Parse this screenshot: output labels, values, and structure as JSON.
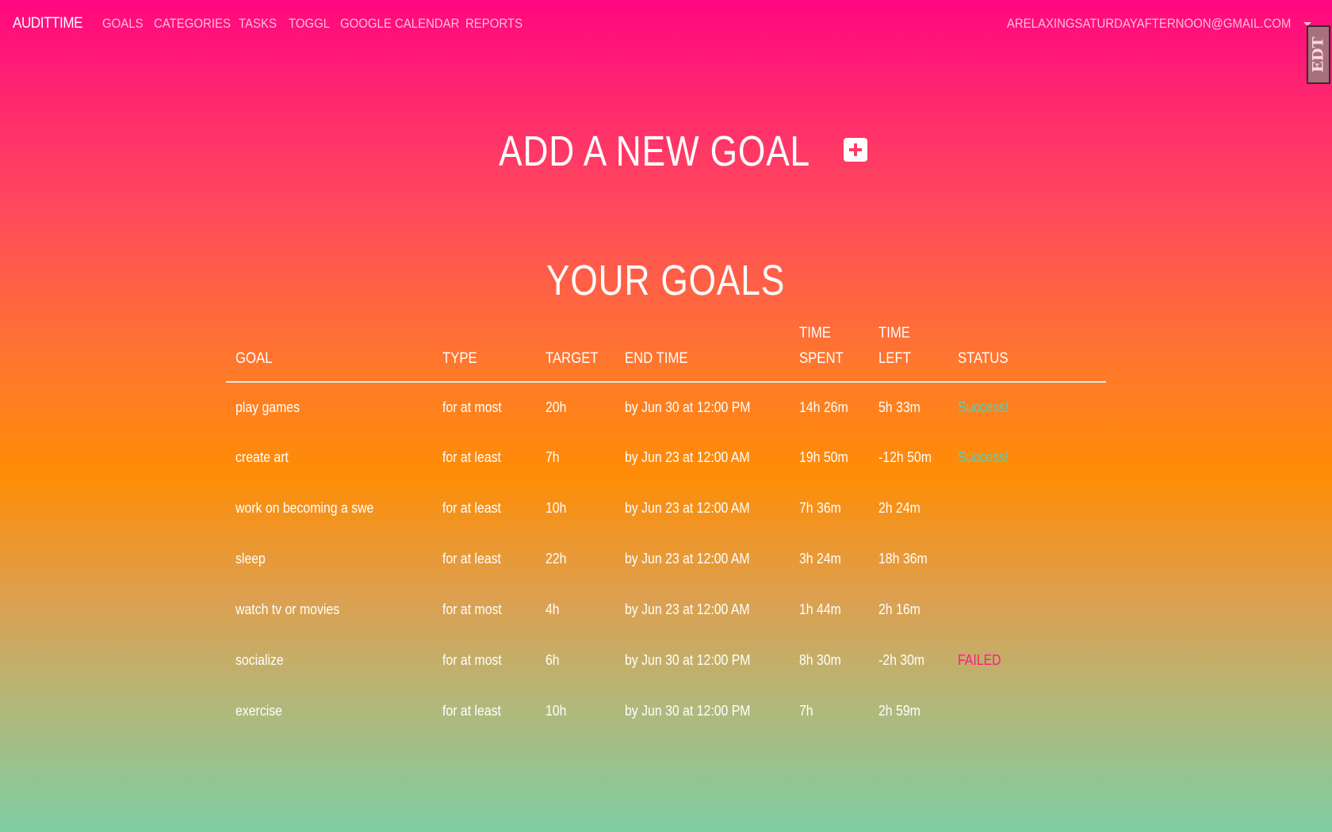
{
  "nav": {
    "brand": "AUDITTIME",
    "items": [
      "GOALS",
      "CATEGORIES",
      "TASKS",
      "TOGGL",
      "GOOGLE CALENDAR",
      "REPORTS"
    ],
    "user_email": "ARELAXINGSATURDAYAFTERNOON@GMAIL.COM",
    "extension_badge": "EDT"
  },
  "add_goal": {
    "title": "ADD A NEW GOAL",
    "icon": "plus-square-icon"
  },
  "goals": {
    "title": "YOUR GOALS",
    "columns": [
      "GOAL",
      "TYPE",
      "TARGET",
      "END TIME",
      "TIME SPENT",
      "TIME LEFT",
      "STATUS"
    ],
    "rows": [
      {
        "goal": "play games",
        "type": "for at most",
        "target": "20h",
        "end": "by Jun 30 at 12:00 PM",
        "spent": "14h 26m",
        "left": "5h 33m",
        "status": "Success!",
        "status_kind": "success"
      },
      {
        "goal": "create art",
        "type": "for at least",
        "target": "7h",
        "end": "by Jun 23 at 12:00 AM",
        "spent": "19h 50m",
        "left": "-12h 50m",
        "status": "Success!",
        "status_kind": "success"
      },
      {
        "goal": "work on becoming a swe",
        "type": "for at least",
        "target": "10h",
        "end": "by Jun 23 at 12:00 AM",
        "spent": "7h 36m",
        "left": "2h 24m",
        "status": "",
        "status_kind": ""
      },
      {
        "goal": "sleep",
        "type": "for at least",
        "target": "22h",
        "end": "by Jun 23 at 12:00 AM",
        "spent": "3h 24m",
        "left": "18h 36m",
        "status": "",
        "status_kind": ""
      },
      {
        "goal": "watch tv or movies",
        "type": "for at most",
        "target": "4h",
        "end": "by Jun 23 at 12:00 AM",
        "spent": "1h 44m",
        "left": "2h 16m",
        "status": "",
        "status_kind": ""
      },
      {
        "goal": "socialize",
        "type": "for at most",
        "target": "6h",
        "end": "by Jun 30 at 12:00 PM",
        "spent": "8h 30m",
        "left": "-2h 30m",
        "status": "FAILED",
        "status_kind": "failed"
      },
      {
        "goal": "exercise",
        "type": "for at least",
        "target": "10h",
        "end": "by Jun 30 at 12:00 PM",
        "spent": "7h",
        "left": "2h 59m",
        "status": "",
        "status_kind": ""
      }
    ]
  },
  "colors": {
    "success": "#45d6c4",
    "failed": "#ff1a86",
    "gradient_top": "#ff0780",
    "gradient_mid": "#ff8c05",
    "gradient_bottom": "#7ecda2"
  }
}
